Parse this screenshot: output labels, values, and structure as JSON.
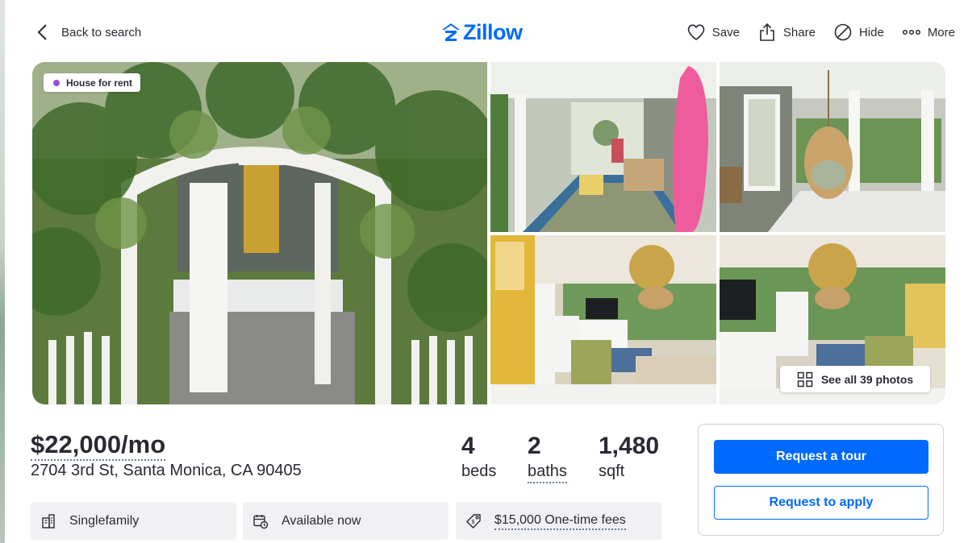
{
  "header": {
    "back_label": "Back to search",
    "logo_text": "Zillow",
    "actions": {
      "save": "Save",
      "share": "Share",
      "hide": "Hide",
      "more": "More"
    }
  },
  "gallery": {
    "badge": "House for rent",
    "see_all": "See all 39 photos"
  },
  "listing": {
    "price": "$22,000/mo",
    "address": "2704 3rd St, Santa Monica, CA 90405",
    "beds": {
      "value": "4",
      "unit": "beds"
    },
    "baths": {
      "value": "2",
      "unit": "baths"
    },
    "sqft": {
      "value": "1,480",
      "unit": "sqft"
    }
  },
  "facts": {
    "type": "Singlefamily",
    "availability": "Available now",
    "fees": "$15,000 One-time fees"
  },
  "cta": {
    "tour": "Request a tour",
    "apply": "Request to apply"
  },
  "colors": {
    "brand": "#006aff",
    "badge_dot": "#9d4cdf",
    "text": "#2a2a33"
  }
}
